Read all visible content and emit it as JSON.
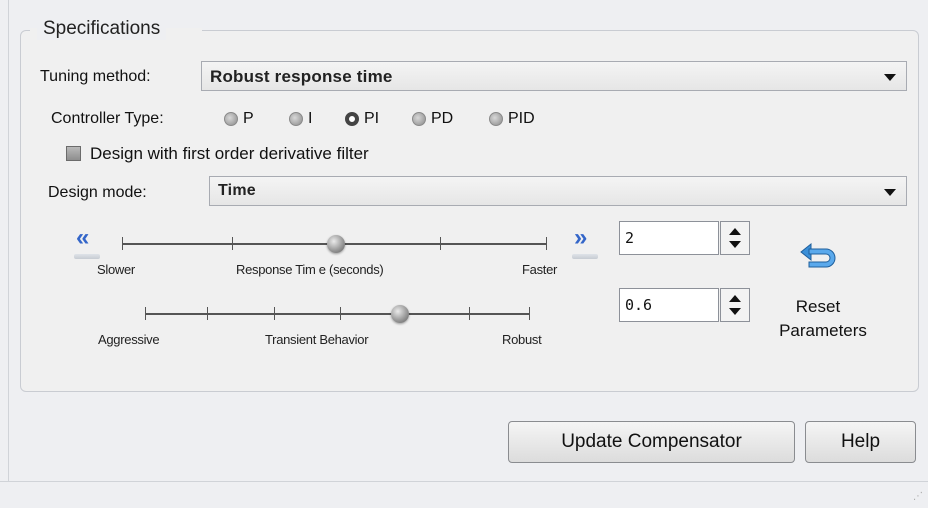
{
  "specifications": {
    "title": "Specifications",
    "tuning_method": {
      "label": "Tuning method:",
      "value": "Robust response time"
    },
    "controller_type": {
      "label": "Controller Type:",
      "options": [
        "P",
        "I",
        "PI",
        "PD",
        "PID"
      ],
      "selected": "PI"
    },
    "derivative_filter": {
      "label": "Design with first order derivative filter",
      "checked": false
    },
    "design_mode": {
      "label": "Design mode:",
      "value": "Time"
    },
    "response_time_slider": {
      "left_label": "Slower",
      "center_label": "Response Tim e (seconds)",
      "right_label": "Faster",
      "left_icon": "double-chevron-left-icon",
      "right_icon": "double-chevron-right-icon",
      "value": "2"
    },
    "transient_slider": {
      "left_label": "Aggressive",
      "center_label": "Transient Behavior",
      "right_label": "Robust",
      "value": "0.6"
    },
    "reset": {
      "line1": "Reset",
      "line2": "Parameters",
      "icon": "undo-arrow-icon"
    }
  },
  "buttons": {
    "update": "Update Compensator",
    "help": "Help"
  },
  "colors": {
    "accent_chevron": "#3466c9",
    "reset_icon": "#3a8fd8"
  }
}
